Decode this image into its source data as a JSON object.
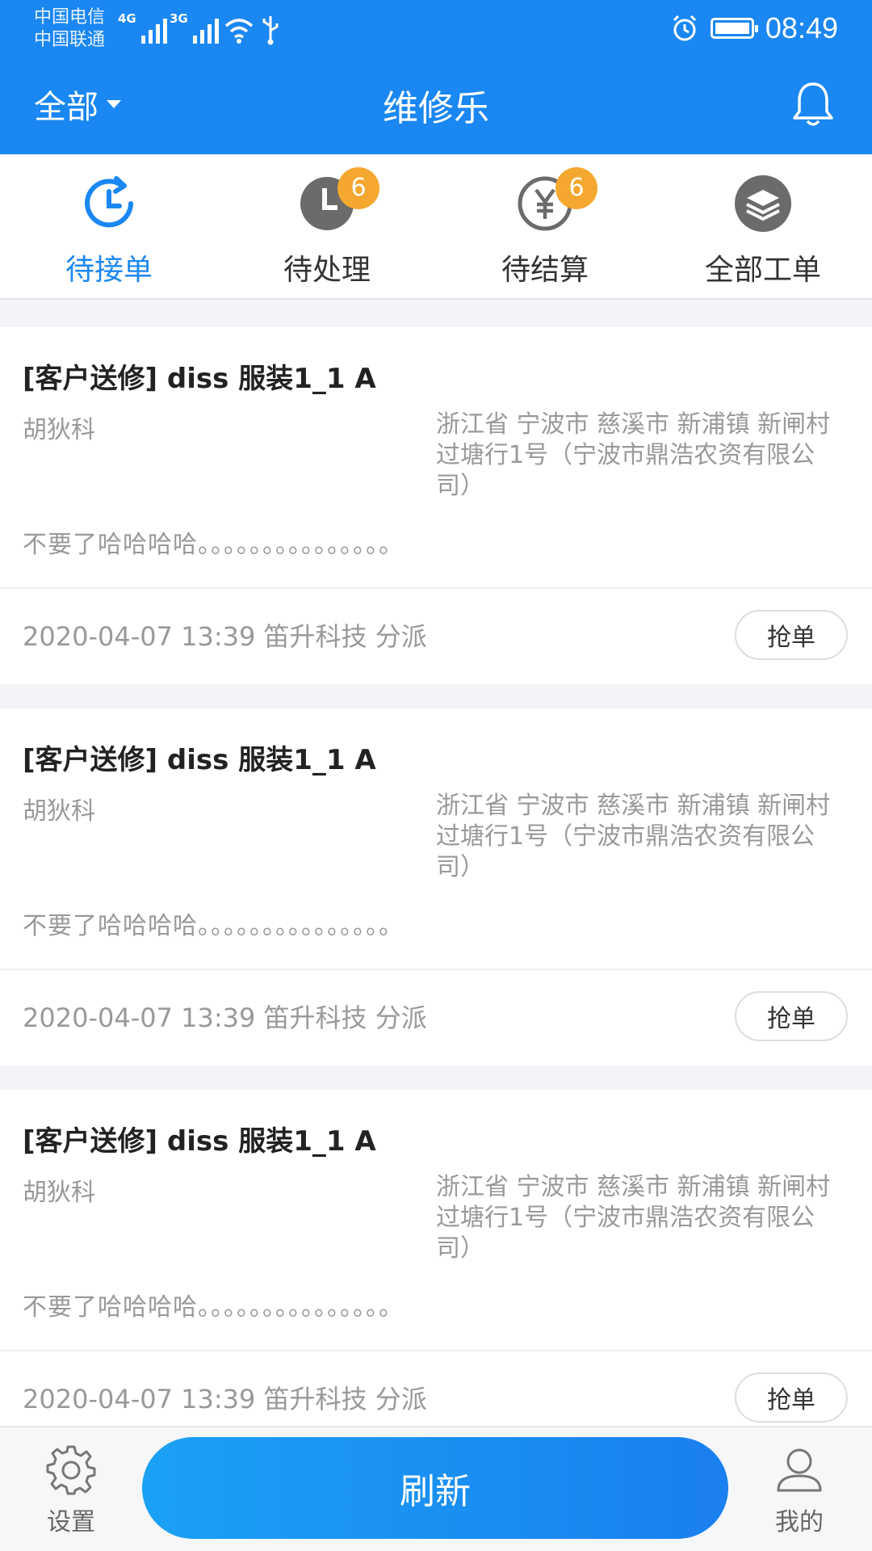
{
  "status_bar": {
    "carrier_1": "中国电信",
    "carrier_2": "中国联通",
    "net_1": "4G",
    "net_2": "3G",
    "time": "08:49"
  },
  "header": {
    "filter_label": "全部",
    "title": "维修乐",
    "icons": [
      "caret-down-icon",
      "bell-icon"
    ],
    "color": "#1a87f2"
  },
  "tabs": [
    {
      "label": "待接单",
      "icon": "clock-refresh-icon",
      "active": true
    },
    {
      "label": "待处理",
      "icon": "clock-icon",
      "badge": "6"
    },
    {
      "label": "待结算",
      "icon": "yen-icon",
      "badge": "6"
    },
    {
      "label": "全部工单",
      "icon": "layers-icon"
    }
  ],
  "orders": [
    {
      "title": "[客户送修] diss 服装1_1 A",
      "customer": "胡狄科",
      "address": "浙江省 宁波市 慈溪市 新浦镇 新闸村过塘行1号（宁波市鼎浩农资有限公司）",
      "note": "不要了哈哈哈哈。。。。。。。。。。。。。。。",
      "meta": "2020-04-07 13:39 笛升科技 分派",
      "action": "抢单"
    },
    {
      "title": "[客户送修] diss 服装1_1 A",
      "customer": "胡狄科",
      "address": "浙江省 宁波市 慈溪市 新浦镇 新闸村过塘行1号（宁波市鼎浩农资有限公司）",
      "note": "不要了哈哈哈哈。。。。。。。。。。。。。。。",
      "meta": "2020-04-07 13:39 笛升科技 分派",
      "action": "抢单"
    },
    {
      "title": "[客户送修] diss 服装1_1 A",
      "customer": "胡狄科",
      "address": "浙江省 宁波市 慈溪市 新浦镇 新闸村过塘行1号（宁波市鼎浩农资有限公司）",
      "note": "不要了哈哈哈哈。。。。。。。。。。。。。。。",
      "meta": "2020-04-07 13:39 笛升科技 分派",
      "action": "抢单"
    }
  ],
  "bottom": {
    "settings_label": "设置",
    "refresh_label": "刷新",
    "profile_label": "我的",
    "icons": [
      "gear-icon",
      "user-icon"
    ]
  },
  "colors": {
    "primary": "#1a87f2",
    "badge": "#f5a830",
    "muted_text": "#999999"
  }
}
